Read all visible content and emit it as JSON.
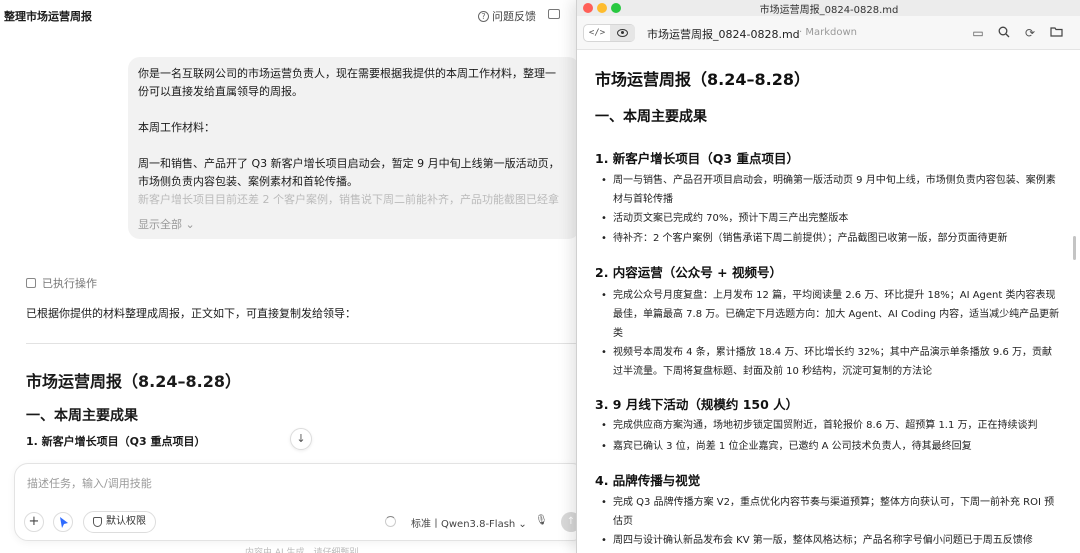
{
  "chat": {
    "header": {
      "title": "整理市场运营周报",
      "feedback": "问题反馈"
    },
    "message": {
      "line1": "你是一名互联网公司的市场运营负责人，现在需要根据我提供的本周工作材料，整理一",
      "line2": "份可以直接发给直属领导的周报。",
      "line3": "本周工作材料：",
      "line4": "周一和销售、产品开了 Q3 新客户增长项目启动会，暂定 9 月中旬上线第一版活动页，",
      "line5": "市场侧负责内容包装、案例素材和首轮传播。",
      "line6": "新客户增长项目目前还差 2 个客户案例，销售说下周二前能补齐，产品功能截图已经拿",
      "show_all": "显示全部 ⌄"
    },
    "executed": "已执行操作",
    "reply": "已根据你提供的材料整理成周报，正文如下，可直接复制发给领导：",
    "doc": {
      "h1": "市场运营周报（8.24–8.28）",
      "h2": "一、本周主要成果",
      "h3": "1. 新客户增长项目（Q3 重点项目）"
    },
    "composer": {
      "placeholder": "描述任务，输入/调用技能",
      "permission": "默认权限",
      "model": "标准丨Qwen3.8-Flash ⌄"
    },
    "footer_hint": "内容由 AI 生成，请仔细甄别"
  },
  "viewer": {
    "window_title": "市场运营周报_0824-0828.md",
    "filename": "市场运营周报_0824-0828.md",
    "filetype": "· Markdown",
    "doc_title": "市场运营周报（8.24–8.28）",
    "section1": "一、本周主要成果",
    "items": [
      {
        "heading": "1. 新客户增长项目（Q3 重点项目）",
        "bullets": [
          "周一与销售、产品召开项目启动会，明确第一版活动页 9 月中旬上线，市场侧负责内容包装、案例素材与首轮传播",
          "活动页文案已完成约 70%，预计下周三产出完整版本",
          "待补齐：2 个客户案例（销售承诺下周二前提供）；产品截图已收第一版，部分页面待更新"
        ]
      },
      {
        "heading": "2. 内容运营（公众号 + 视频号）",
        "bullets": [
          "完成公众号月度复盘：上月发布 12 篇，平均阅读量 2.6 万、环比提升 18%；AI Agent 类内容表现最佳，单篇最高 7.8 万。已确定下月选题方向：加大 Agent、AI Coding 内容，适当减少纯产品更新类",
          "视频号本周发布 4 条，累计播放 18.4 万、环比增长约 32%；其中产品演示单条播放 9.6 万，贡献过半流量。下周将复盘标题、封面及前 10 秒结构，沉淀可复制的方法论"
        ]
      },
      {
        "heading": "3. 9 月线下活动（规模约 150 人）",
        "bullets": [
          "完成供应商方案沟通，场地初步锁定国贸附近，首轮报价 8.6 万、超预算 1.1 万，正在持续谈判",
          "嘉宾已确认 3 位，尚差 1 位企业嘉宾，已邀约 A 公司技术负责人，待其最终回复"
        ]
      },
      {
        "heading": "4. 品牌传播与视觉",
        "bullets": [
          "完成 Q3 品牌传播方案 V2，重点优化内容节奏与渠道预算；整体方向获认可，下周一前补充 ROI 预估页",
          "周四与设计确认新品发布会 KV 第一版，整体风格达标；产品名称字号偏小问题已于周五反馈修"
        ]
      }
    ]
  }
}
